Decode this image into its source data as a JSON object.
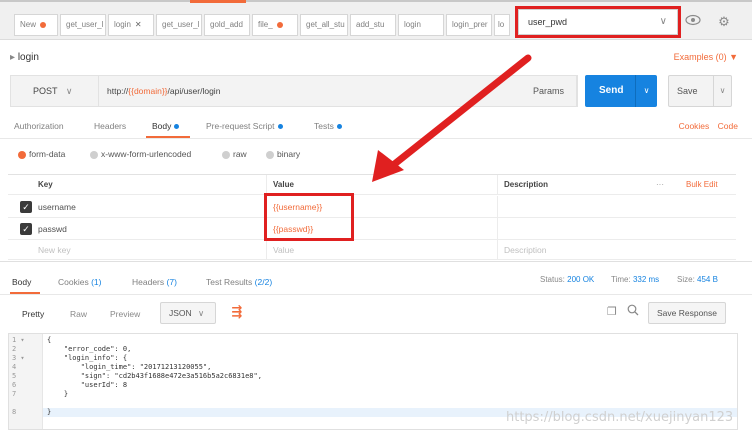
{
  "tabs": [
    {
      "label": "New",
      "dot": true
    },
    {
      "label": "get_user_l",
      "dot": false
    },
    {
      "label": "login",
      "dot": false,
      "close": "✕"
    },
    {
      "label": "get_user_l",
      "dot": false
    },
    {
      "label": "gold_add",
      "dot": false
    },
    {
      "label": "file_",
      "dot": true
    },
    {
      "label": "get_all_stu",
      "dot": false
    },
    {
      "label": "add_stu",
      "dot": false
    },
    {
      "label": "login",
      "dot": false
    },
    {
      "label": "login_prer",
      "dot": false
    },
    {
      "label": "lo",
      "dot": false
    }
  ],
  "environment": {
    "selected": "user_pwd"
  },
  "request": {
    "name": "login",
    "examples": "Examples (0) ▼",
    "method": "POST",
    "url_prefix": "http://",
    "url_var": "{{domain}}",
    "url_suffix": "/api/user/login",
    "params_label": "Params",
    "send_label": "Send",
    "save_label": "Save"
  },
  "request_tabs": [
    {
      "label": "Authorization",
      "dot": false
    },
    {
      "label": "Headers",
      "dot": false
    },
    {
      "label": "Body",
      "dot": true
    },
    {
      "label": "Pre-request Script",
      "dot": true
    },
    {
      "label": "Tests",
      "dot": true
    }
  ],
  "cookies_label": "Cookies",
  "code_label": "Code",
  "body_types": [
    {
      "label": "form-data",
      "selected": true
    },
    {
      "label": "x-www-form-urlencoded",
      "selected": false
    },
    {
      "label": "raw",
      "selected": false
    },
    {
      "label": "binary",
      "selected": false
    }
  ],
  "table": {
    "headers": {
      "key": "Key",
      "value": "Value",
      "description": "Description",
      "more": "···",
      "bulk_edit": "Bulk Edit"
    },
    "rows": [
      {
        "key": "username",
        "value": "{{username}}",
        "checked": true
      },
      {
        "key": "passwd",
        "value": "{{passwd}}",
        "checked": true
      }
    ],
    "placeholder": {
      "key": "New key",
      "value": "Value",
      "description": "Description"
    }
  },
  "response": {
    "tabs": [
      {
        "label": "Body",
        "count": ""
      },
      {
        "label": "Cookies",
        "count": "(1)"
      },
      {
        "label": "Headers",
        "count": "(7)"
      },
      {
        "label": "Test Results",
        "count": "(2/2)"
      }
    ],
    "status_label": "Status:",
    "status_value": "200 OK",
    "time_label": "Time:",
    "time_value": "332 ms",
    "size_label": "Size:",
    "size_value": "454 B",
    "view_modes": [
      "Pretty",
      "Raw",
      "Preview"
    ],
    "format": "JSON",
    "save_response": "Save Response",
    "line_numbers": [
      "1 ▾",
      "2",
      "3 ▾",
      "4",
      "5",
      "6",
      "7",
      "8"
    ],
    "code_lines": [
      "{",
      "    \"error_code\": 0,",
      "    \"login_info\": {",
      "        \"login_time\": \"20171213120055\",",
      "        \"sign\": \"cd2b43f1688e472e3a516b5a2c6831e8\",",
      "        \"userId\": 8",
      "    }",
      "}"
    ]
  },
  "watermark": "https://blog.csdn.net/xuejinyan123",
  "colors": {
    "accent": "#f26b3a",
    "primary": "#1683e0",
    "annotation_red": "#e02020"
  }
}
